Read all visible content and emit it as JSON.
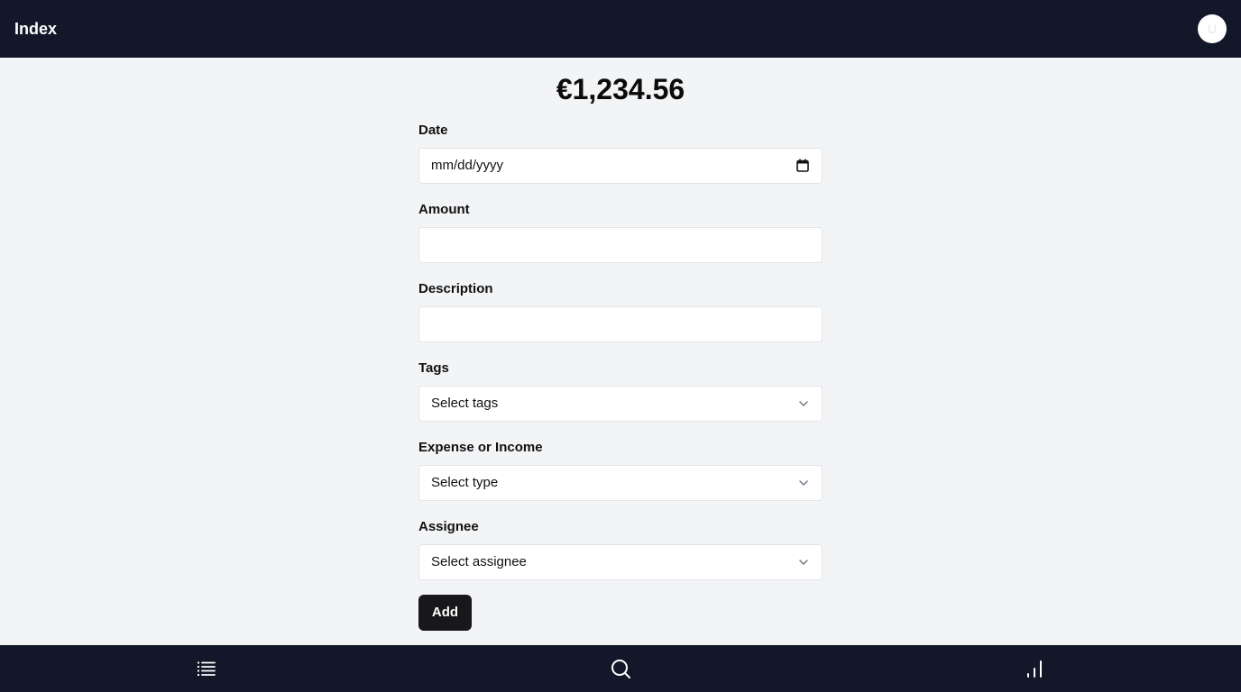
{
  "header": {
    "title": "Index",
    "avatar_initial": "U"
  },
  "summary": {
    "balance": "€1,234.56"
  },
  "form": {
    "date": {
      "label": "Date",
      "placeholder": "mm/dd/yyyy",
      "icon": "calendar-icon"
    },
    "amount": {
      "label": "Amount",
      "value": ""
    },
    "description": {
      "label": "Description",
      "value": ""
    },
    "tags": {
      "label": "Tags",
      "selected": "Select tags",
      "icon": "chevron-down-icon"
    },
    "type": {
      "label": "Expense or Income",
      "selected": "Select type",
      "icon": "chevron-down-icon"
    },
    "assignee": {
      "label": "Assignee",
      "selected": "Select assignee",
      "icon": "chevron-down-icon"
    },
    "submit_label": "Add"
  },
  "bottom_nav": {
    "items": [
      {
        "name": "list",
        "icon": "list-icon"
      },
      {
        "name": "search",
        "icon": "search-icon"
      },
      {
        "name": "stats",
        "icon": "bar-chart-icon"
      }
    ]
  },
  "colors": {
    "bar_background": "#121829",
    "page_background": "#f3f4f6",
    "button_background": "#18181b"
  }
}
